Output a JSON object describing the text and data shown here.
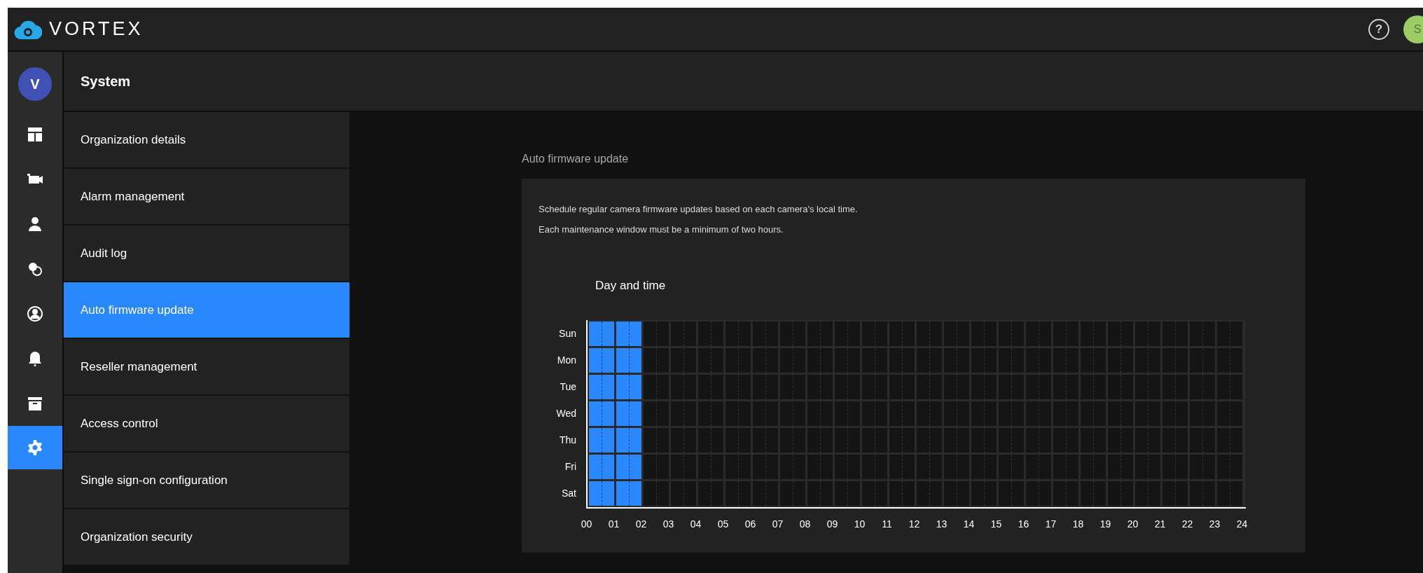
{
  "brand": {
    "name": "VORTEX"
  },
  "header": {
    "help_glyph": "?",
    "user_initial": "S"
  },
  "rail": {
    "org_initial": "V",
    "items": [
      {
        "kind": "dashboard",
        "selected": false
      },
      {
        "kind": "cameras",
        "selected": false
      },
      {
        "kind": "person",
        "selected": false
      },
      {
        "kind": "circles",
        "selected": false
      },
      {
        "kind": "user-circle",
        "selected": false
      },
      {
        "kind": "bell",
        "selected": false
      },
      {
        "kind": "archive",
        "selected": false
      },
      {
        "kind": "settings",
        "selected": true
      }
    ]
  },
  "section_title": "System",
  "menu": [
    {
      "label": "Organization details",
      "selected": false
    },
    {
      "label": "Alarm management",
      "selected": false
    },
    {
      "label": "Audit log",
      "selected": false
    },
    {
      "label": "Auto firmware update",
      "selected": true
    },
    {
      "label": "Reseller management",
      "selected": false
    },
    {
      "label": "Access control",
      "selected": false
    },
    {
      "label": "Single sign-on configuration",
      "selected": false
    },
    {
      "label": "Organization security",
      "selected": false
    }
  ],
  "panel": {
    "title": "Auto firmware update",
    "description": [
      "Schedule regular camera firmware updates based on each camera's local time.",
      "Each maintenance window must be a minimum of two hours."
    ],
    "schedule": {
      "title": "Day and time",
      "days": [
        {
          "label": "Sun",
          "hours": [
            true,
            true,
            false,
            false,
            false,
            false,
            false,
            false,
            false,
            false,
            false,
            false,
            false,
            false,
            false,
            false,
            false,
            false,
            false,
            false,
            false,
            false,
            false,
            false
          ]
        },
        {
          "label": "Mon",
          "hours": [
            true,
            true,
            false,
            false,
            false,
            false,
            false,
            false,
            false,
            false,
            false,
            false,
            false,
            false,
            false,
            false,
            false,
            false,
            false,
            false,
            false,
            false,
            false,
            false
          ]
        },
        {
          "label": "Tue",
          "hours": [
            true,
            true,
            false,
            false,
            false,
            false,
            false,
            false,
            false,
            false,
            false,
            false,
            false,
            false,
            false,
            false,
            false,
            false,
            false,
            false,
            false,
            false,
            false,
            false
          ]
        },
        {
          "label": "Wed",
          "hours": [
            true,
            true,
            false,
            false,
            false,
            false,
            false,
            false,
            false,
            false,
            false,
            false,
            false,
            false,
            false,
            false,
            false,
            false,
            false,
            false,
            false,
            false,
            false,
            false
          ]
        },
        {
          "label": "Thu",
          "hours": [
            true,
            true,
            false,
            false,
            false,
            false,
            false,
            false,
            false,
            false,
            false,
            false,
            false,
            false,
            false,
            false,
            false,
            false,
            false,
            false,
            false,
            false,
            false,
            false
          ]
        },
        {
          "label": "Fri",
          "hours": [
            true,
            true,
            false,
            false,
            false,
            false,
            false,
            false,
            false,
            false,
            false,
            false,
            false,
            false,
            false,
            false,
            false,
            false,
            false,
            false,
            false,
            false,
            false,
            false
          ]
        },
        {
          "label": "Sat",
          "hours": [
            true,
            true,
            false,
            false,
            false,
            false,
            false,
            false,
            false,
            false,
            false,
            false,
            false,
            false,
            false,
            false,
            false,
            false,
            false,
            false,
            false,
            false,
            false,
            false
          ]
        }
      ],
      "hour_labels": [
        "00",
        "01",
        "02",
        "03",
        "04",
        "05",
        "06",
        "07",
        "08",
        "09",
        "10",
        "11",
        "12",
        "13",
        "14",
        "15",
        "16",
        "17",
        "18",
        "19",
        "20",
        "21",
        "22",
        "23",
        "24"
      ]
    }
  }
}
